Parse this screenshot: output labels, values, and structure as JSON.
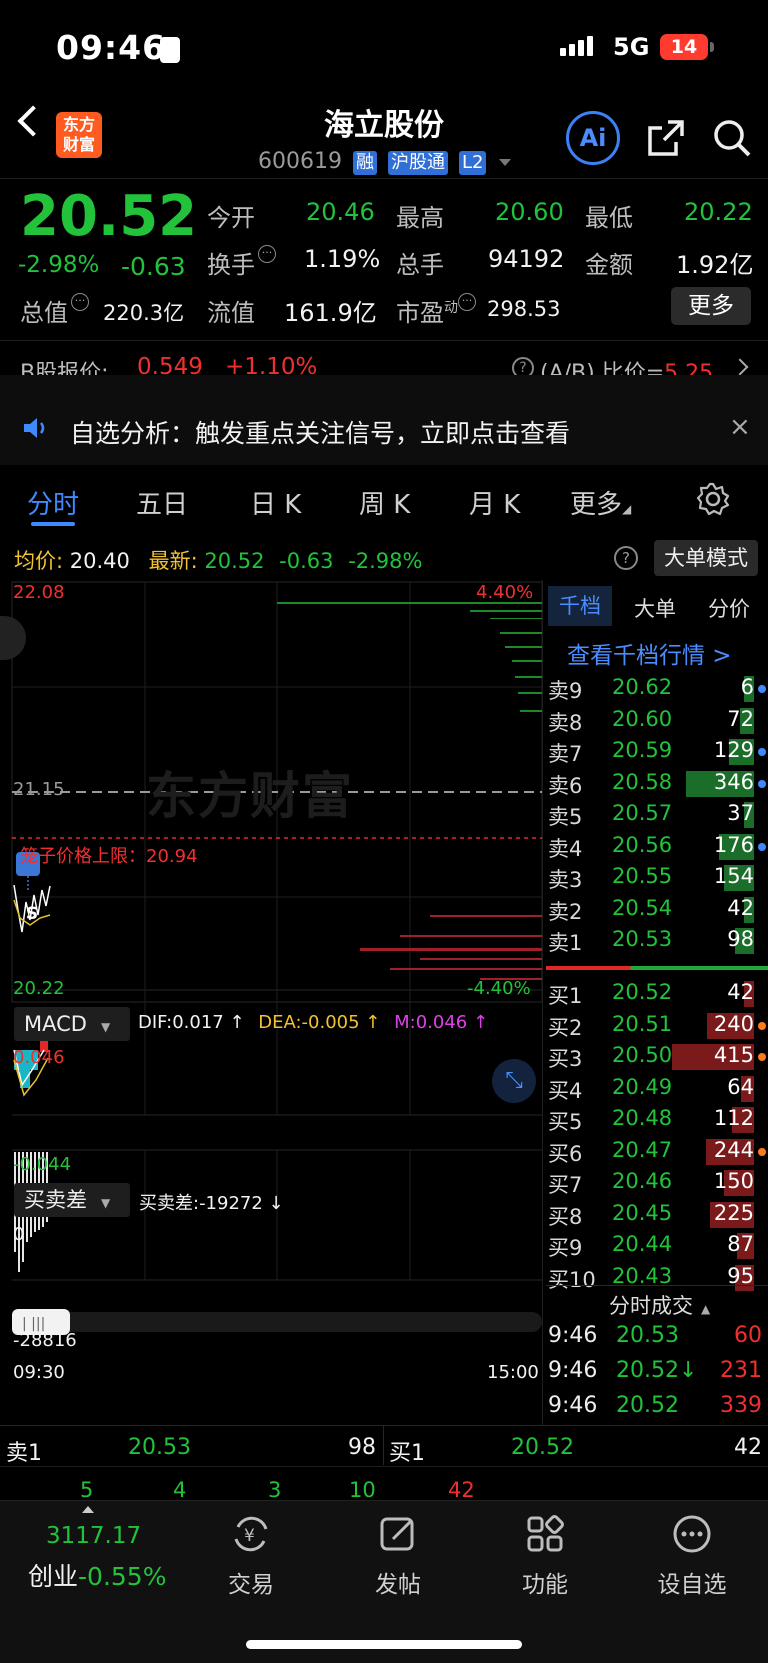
{
  "status": {
    "time": "09:46",
    "network": "5G",
    "battery": "14"
  },
  "header": {
    "logo_text": "东方财富",
    "stock_name": "海立股份",
    "stock_code": "600619",
    "tags": [
      "融",
      "沪股通",
      "L2"
    ],
    "ai_label": "Ai"
  },
  "quote": {
    "price": "20.52",
    "change_pct": "-2.98%",
    "change_val": "-0.63",
    "open_label": "今开",
    "open": "20.46",
    "high_label": "最高",
    "high": "20.60",
    "low_label": "最低",
    "low": "20.22",
    "turnover_label": "换手",
    "turnover": "1.19%",
    "volume_label": "总手",
    "volume": "94192",
    "amount_label": "金额",
    "amount": "1.92亿",
    "mktcap_label": "总值",
    "mktcap": "220.3亿",
    "float_label": "流值",
    "float": "161.9亿",
    "pe_label": "市盈",
    "pe_sup": "动",
    "pe": "298.53",
    "more_label": "更多"
  },
  "bshare": {
    "label": "B股报价:",
    "price": "0.549",
    "change": "+1.10%",
    "ratio_label": "(A/B) 比价=",
    "ratio": "5.25"
  },
  "notice": {
    "text": "自选分析：触发重点关注信号，立即点击查看"
  },
  "tabs": [
    "分时",
    "五日",
    "日 K",
    "周 K",
    "月 K",
    "更多"
  ],
  "chart_header": {
    "avg_label": "均价:",
    "avg": "20.40",
    "last_label": "最新:",
    "last": "20.52",
    "chg": "-0.63",
    "pct": "-2.98%",
    "mode_btn": "大单模式"
  },
  "main_chart": {
    "y_top": "22.08",
    "y_mid": "21.15",
    "y_bottom": "20.22",
    "pct_top": "4.40%",
    "pct_bottom": "-4.40%",
    "limit_label": "笼子价格上限：20.94",
    "watermark": "东方财富",
    "time_start": "09:30",
    "time_end": "15:00"
  },
  "macd": {
    "label": "MACD",
    "dif": "DIF:0.017 ↑",
    "dea": "DEA:-0.005 ↑",
    "m": "M:0.046 ↑",
    "top": "0.046",
    "bottom": "-0.044"
  },
  "spread": {
    "label": "买卖差",
    "value": "买卖差:-19272 ↓",
    "top": "0",
    "bottom": "-28816"
  },
  "orderbook": {
    "tabs": [
      "千档",
      "大单",
      "分价"
    ],
    "link": "查看千档行情 >",
    "asks": [
      {
        "label": "卖9",
        "price": "20.62",
        "vol": "6"
      },
      {
        "label": "卖8",
        "price": "20.60",
        "vol": "72"
      },
      {
        "label": "卖7",
        "price": "20.59",
        "vol": "129"
      },
      {
        "label": "卖6",
        "price": "20.58",
        "vol": "346"
      },
      {
        "label": "卖5",
        "price": "20.57",
        "vol": "37"
      },
      {
        "label": "卖4",
        "price": "20.56",
        "vol": "176"
      },
      {
        "label": "卖3",
        "price": "20.55",
        "vol": "154"
      },
      {
        "label": "卖2",
        "price": "20.54",
        "vol": "42"
      },
      {
        "label": "卖1",
        "price": "20.53",
        "vol": "98"
      }
    ],
    "bids": [
      {
        "label": "买1",
        "price": "20.52",
        "vol": "42"
      },
      {
        "label": "买2",
        "price": "20.51",
        "vol": "240"
      },
      {
        "label": "买3",
        "price": "20.50",
        "vol": "415"
      },
      {
        "label": "买4",
        "price": "20.49",
        "vol": "64"
      },
      {
        "label": "买5",
        "price": "20.48",
        "vol": "112"
      },
      {
        "label": "买6",
        "price": "20.47",
        "vol": "244"
      },
      {
        "label": "买7",
        "price": "20.46",
        "vol": "150"
      },
      {
        "label": "买8",
        "price": "20.45",
        "vol": "225"
      },
      {
        "label": "买9",
        "price": "20.44",
        "vol": "87"
      },
      {
        "label": "买10",
        "price": "20.43",
        "vol": "95"
      }
    ],
    "ticks_label": "分时成交",
    "ticks": [
      {
        "time": "9:46",
        "price": "20.53",
        "vol": "60"
      },
      {
        "time": "9:46",
        "price": "20.52↓",
        "vol": "231"
      },
      {
        "time": "9:46",
        "price": "20.52",
        "vol": "339"
      }
    ]
  },
  "level1": {
    "sell_label": "卖1",
    "sell_price": "20.53",
    "sell_vol": "98",
    "buy_label": "买1",
    "buy_price": "20.52",
    "buy_vol": "42",
    "sell_queue": [
      "5",
      "4",
      "3",
      "10"
    ],
    "buy_queue": [
      "42"
    ]
  },
  "bottom_nav": {
    "index_value": "3117.17",
    "index_name": "创业",
    "index_change": "-0.55%",
    "items": [
      "交易",
      "发帖",
      "功能",
      "设自选"
    ]
  }
}
